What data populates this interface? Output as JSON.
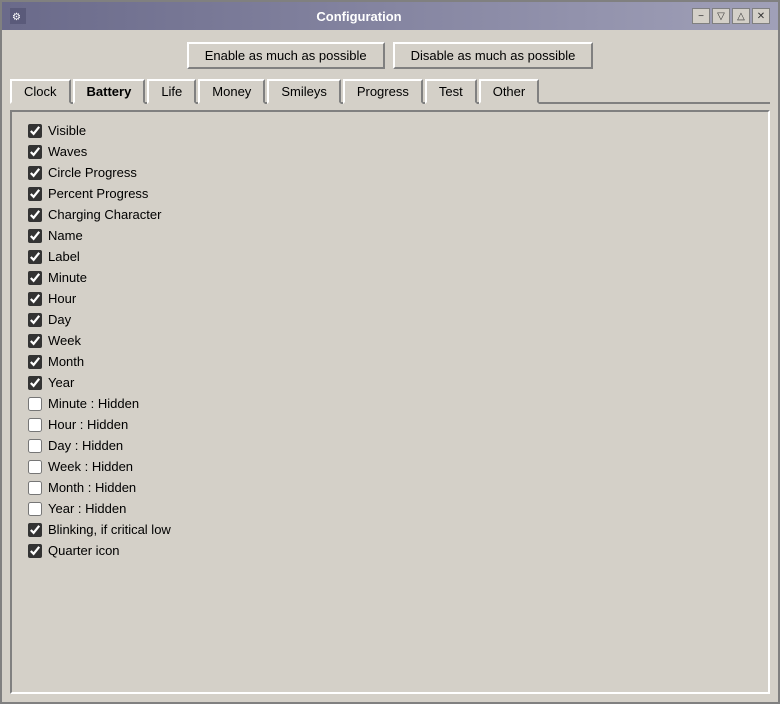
{
  "window": {
    "title": "Configuration"
  },
  "titlebar": {
    "minimize_label": "−",
    "restore_label": "▽",
    "maximize_label": "△",
    "close_label": "✕"
  },
  "buttons": {
    "enable_label": "Enable as much as possible",
    "disable_label": "Disable as much as possible"
  },
  "tabs": [
    {
      "id": "clock",
      "label": "Clock",
      "active": false
    },
    {
      "id": "battery",
      "label": "Battery",
      "active": true
    },
    {
      "id": "life",
      "label": "Life",
      "active": false
    },
    {
      "id": "money",
      "label": "Money",
      "active": false
    },
    {
      "id": "smileys",
      "label": "Smileys",
      "active": false
    },
    {
      "id": "progress",
      "label": "Progress",
      "active": false
    },
    {
      "id": "test",
      "label": "Test",
      "active": false
    },
    {
      "id": "other",
      "label": "Other",
      "active": false
    }
  ],
  "checkboxes": [
    {
      "id": "visible",
      "label": "Visible",
      "checked": true
    },
    {
      "id": "waves",
      "label": "Waves",
      "checked": true
    },
    {
      "id": "circle_progress",
      "label": "Circle Progress",
      "checked": true
    },
    {
      "id": "percent_progress",
      "label": "Percent Progress",
      "checked": true
    },
    {
      "id": "charging_character",
      "label": "Charging Character",
      "checked": true
    },
    {
      "id": "name",
      "label": "Name",
      "checked": true
    },
    {
      "id": "label",
      "label": "Label",
      "checked": true
    },
    {
      "id": "minute",
      "label": "Minute",
      "checked": true
    },
    {
      "id": "hour",
      "label": "Hour",
      "checked": true
    },
    {
      "id": "day",
      "label": "Day",
      "checked": true
    },
    {
      "id": "week",
      "label": "Week",
      "checked": true
    },
    {
      "id": "month",
      "label": "Month",
      "checked": true
    },
    {
      "id": "year",
      "label": "Year",
      "checked": true
    },
    {
      "id": "minute_hidden",
      "label": "Minute : Hidden",
      "checked": false
    },
    {
      "id": "hour_hidden",
      "label": "Hour : Hidden",
      "checked": false
    },
    {
      "id": "day_hidden",
      "label": "Day : Hidden",
      "checked": false
    },
    {
      "id": "week_hidden",
      "label": "Week : Hidden",
      "checked": false
    },
    {
      "id": "month_hidden",
      "label": "Month : Hidden",
      "checked": false
    },
    {
      "id": "year_hidden",
      "label": "Year : Hidden",
      "checked": false
    },
    {
      "id": "blinking_critical",
      "label": "Blinking, if critical low",
      "checked": true
    },
    {
      "id": "quarter_icon",
      "label": "Quarter icon",
      "checked": true
    }
  ]
}
